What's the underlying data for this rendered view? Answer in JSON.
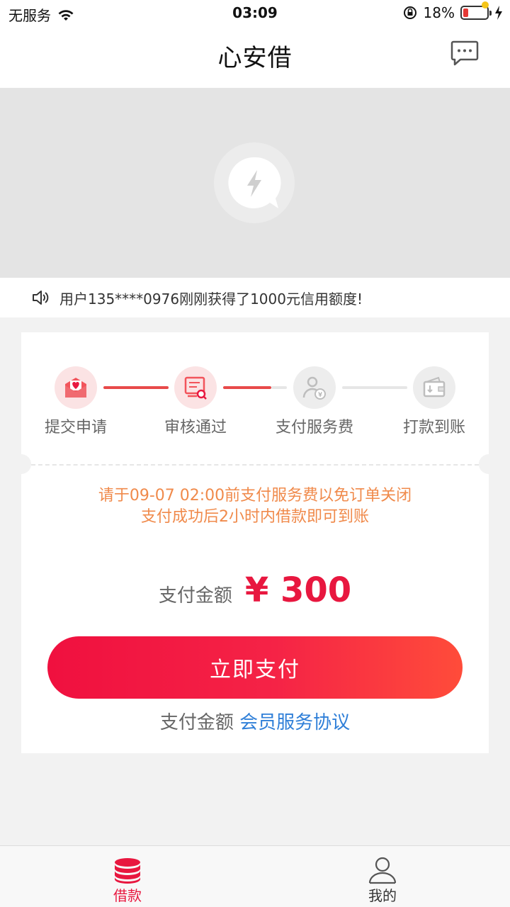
{
  "status_bar": {
    "carrier": "无服务",
    "time": "03:09",
    "battery_percent": "18%"
  },
  "header": {
    "title": "心安借",
    "message_icon": "chat-bubble-icon"
  },
  "notice": {
    "text": "用户135****0976刚刚获得了1000元信用额度!"
  },
  "steps": [
    {
      "label": "提交申请",
      "icon": "envelope-heart-icon",
      "state": "done"
    },
    {
      "label": "审核通过",
      "icon": "document-search-icon",
      "state": "done"
    },
    {
      "label": "支付服务费",
      "icon": "user-yen-icon",
      "state": "pending"
    },
    {
      "label": "打款到账",
      "icon": "wallet-icon",
      "state": "pending"
    }
  ],
  "warning": {
    "line1": "请于09-07 02:00前支付服务费以免订单关闭",
    "line2": "支付成功后2小时内借款即可到账"
  },
  "payment": {
    "amount_label": "支付金额",
    "amount_value": "¥ 300",
    "pay_button": "立即支付",
    "agreement_prefix": "支付金额",
    "agreement_link": "会员服务协议"
  },
  "tabbar": {
    "tabs": [
      {
        "label": "借款",
        "icon": "coin-stack-icon",
        "active": true
      },
      {
        "label": "我的",
        "icon": "user-icon",
        "active": false
      }
    ]
  },
  "colors": {
    "accent": "#e8173f",
    "warning": "#f08a4b",
    "link": "#2f7fd8",
    "step_active": "#e84a4a"
  }
}
